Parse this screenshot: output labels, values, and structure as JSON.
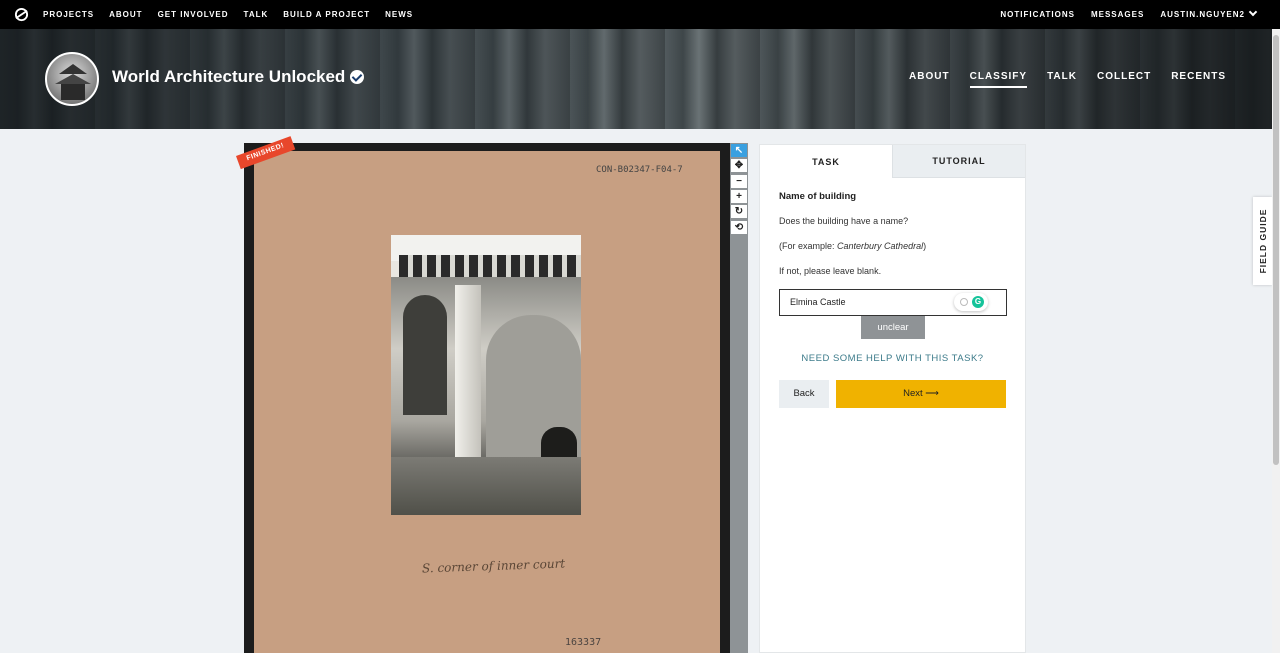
{
  "topnav": {
    "links": [
      "PROJECTS",
      "ABOUT",
      "GET INVOLVED",
      "TALK",
      "BUILD A PROJECT",
      "NEWS"
    ],
    "right": [
      "NOTIFICATIONS",
      "MESSAGES",
      "AUSTIN.NGUYEN2"
    ]
  },
  "project": {
    "title": "World Architecture Unlocked",
    "nav": [
      "ABOUT",
      "CLASSIFY",
      "TALK",
      "COLLECT",
      "RECENTS"
    ],
    "active_nav": "CLASSIFY"
  },
  "subject": {
    "badge": "FINISHED!",
    "reference": "CON-B02347-F04-7",
    "caption": "S. corner of inner court",
    "stamp": "163337"
  },
  "tools": {
    "pointer": "↖",
    "pan": "✥",
    "zoom_out": "−",
    "zoom_in": "+",
    "rotate": "↻",
    "reset": "⟲"
  },
  "task": {
    "tabs": [
      "TASK",
      "TUTORIAL"
    ],
    "question_title": "Name of building",
    "line1": "Does the building have a name?",
    "line2_prefix": "(For example: ",
    "line2_example": "Canterbury Cathedral",
    "line2_suffix": ")",
    "line3": "If not, please leave blank.",
    "answer_value": "Elmina Castle",
    "grammarly_letter": "G",
    "unclear_label": "unclear",
    "help_label": "NEED SOME HELP WITH THIS TASK?",
    "back_label": "Back",
    "next_label": "Next ⟶"
  },
  "field_guide": "FIELD GUIDE",
  "colors": {
    "accent_yellow": "#f0b200",
    "badge_red": "#e8472b",
    "tool_active": "#3aa0e0",
    "help_link": "#3c7b8a"
  }
}
